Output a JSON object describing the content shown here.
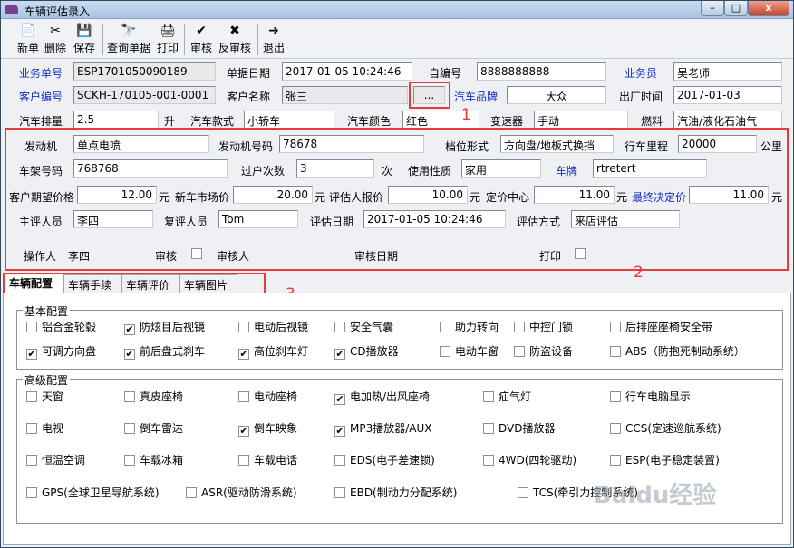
{
  "window": {
    "title": "车辆评估录入",
    "min": "–",
    "max": "□",
    "close": "x"
  },
  "toolbar": [
    {
      "label": "新单",
      "icon": "📄"
    },
    {
      "label": "删除",
      "icon": "✂"
    },
    {
      "label": "保存",
      "icon": "💾"
    },
    {
      "label": "查询单据",
      "icon": "🔭"
    },
    {
      "label": "打印",
      "icon": "🖨"
    },
    {
      "label": "审核",
      "icon": "✔"
    },
    {
      "label": "反审核",
      "icon": "✖"
    },
    {
      "label": "退出",
      "icon": "➜"
    }
  ],
  "header": {
    "order_no_label": "业务单号",
    "order_no": "ESP1701050090189",
    "order_date_label": "单据日期",
    "order_date": "2017-01-05 10:24:46",
    "self_no_label": "自编号",
    "self_no": "8888888888",
    "salesman_label": "业务员",
    "salesman": "吴老师",
    "cust_no_label": "客户编号",
    "cust_no": "SCKH-170105-001-0001",
    "cust_name_label": "客户名称",
    "cust_name": "张三",
    "browse": "...",
    "brand_label": "汽车品牌",
    "brand": "大众",
    "factory_date_label": "出厂时间",
    "factory_date": "2017-01-03",
    "displacement_label": "汽车排量",
    "displacement": "2.5",
    "displacement_unit": "升",
    "style_label": "汽车款式",
    "style": "小轿车",
    "color_label": "汽车颜色",
    "color": "红色",
    "gearbox_label": "变速器",
    "gearbox": "手动",
    "fuel_label": "燃料",
    "fuel": "汽油/液化石油气"
  },
  "annotations": {
    "a1": "1",
    "a2": "2",
    "a3": "3"
  },
  "details": {
    "engine_label": "发动机",
    "engine": "单点电喷",
    "engine_no_label": "发动机号码",
    "engine_no": "78678",
    "gear_label": "档位形式",
    "gear": "方向盘/地板式换挡",
    "mileage_label": "行车里程",
    "mileage": "20000",
    "mileage_unit": "公里",
    "frame_label": "车架号码",
    "frame": "768768",
    "transfer_label": "过户次数",
    "transfer": "3",
    "transfer_unit": "次",
    "usage_label": "使用性质",
    "usage": "家用",
    "plate_label": "车牌",
    "plate": "rtretert",
    "expect_label": "客户期望价格",
    "expect": "12.00",
    "yuan": "元",
    "newprice_label": "新车市场价",
    "newprice": "20.00",
    "assessor_price_label": "评估人报价",
    "assessor_price": "10.00",
    "center_label": "定价中心",
    "center": "11.00",
    "final_label": "最终决定价",
    "final": "11.00",
    "chief_label": "主评人员",
    "chief": "李四",
    "review_label": "复评人员",
    "review": "Tom",
    "eval_date_label": "评估日期",
    "eval_date": "2017-01-05 10:24:46",
    "method_label": "评估方式",
    "method": "来店评估",
    "operator_label": "操作人",
    "operator": "李四",
    "audit_label": "审核",
    "auditor_label": "审核人",
    "audit_date_label": "审核日期",
    "print_label": "打印"
  },
  "tabs": [
    "车辆配置",
    "车辆手续",
    "车辆评价",
    "车辆图片"
  ],
  "basic": {
    "title": "基本配置",
    "items": [
      {
        "label": "铝合金轮毂",
        "checked": false
      },
      {
        "label": "防炫目后视镜",
        "checked": true
      },
      {
        "label": "电动后视镜",
        "checked": false
      },
      {
        "label": "安全气囊",
        "checked": false
      },
      {
        "label": "助力转向",
        "checked": false
      },
      {
        "label": "中控门锁",
        "checked": false
      },
      {
        "label": "后排座座椅安全带",
        "checked": false
      },
      {
        "label": "可调方向盘",
        "checked": true
      },
      {
        "label": "前后盘式刹车",
        "checked": true
      },
      {
        "label": "高位刹车灯",
        "checked": true
      },
      {
        "label": "CD播放器",
        "checked": true
      },
      {
        "label": "电动车窗",
        "checked": false
      },
      {
        "label": "防盗设备",
        "checked": false
      },
      {
        "label": "ABS（防抱死制动系统）",
        "checked": false
      }
    ]
  },
  "advanced": {
    "title": "高级配置",
    "items": [
      {
        "label": "天窗",
        "checked": false
      },
      {
        "label": "真皮座椅",
        "checked": false
      },
      {
        "label": "电动座椅",
        "checked": false
      },
      {
        "label": "电加热/出风座椅",
        "checked": true
      },
      {
        "label": "疝气灯",
        "checked": false
      },
      {
        "label": "行车电脑显示",
        "checked": false
      },
      {
        "label": "电视",
        "checked": false
      },
      {
        "label": "倒车雷达",
        "checked": false
      },
      {
        "label": "倒车映象",
        "checked": true
      },
      {
        "label": "MP3播放器/AUX",
        "checked": true
      },
      {
        "label": "DVD播放器",
        "checked": false
      },
      {
        "label": "CCS(定速巡航系统)",
        "checked": false
      },
      {
        "label": "恒温空调",
        "checked": false
      },
      {
        "label": "车载冰箱",
        "checked": false
      },
      {
        "label": "车载电话",
        "checked": false
      },
      {
        "label": "EDS(电子差速锁)",
        "checked": false
      },
      {
        "label": "4WD(四轮驱动)",
        "checked": false
      },
      {
        "label": "ESP(电子稳定装置)",
        "checked": false
      },
      {
        "label": "GPS(全球卫星导航系统)",
        "checked": false
      },
      {
        "label": "ASR(驱动防滑系统)",
        "checked": false
      },
      {
        "label": "EBD(制动力分配系统)",
        "checked": false
      },
      {
        "label": "TCS(牵引力控制系统)",
        "checked": false
      }
    ]
  },
  "watermark": "Baidu经验"
}
